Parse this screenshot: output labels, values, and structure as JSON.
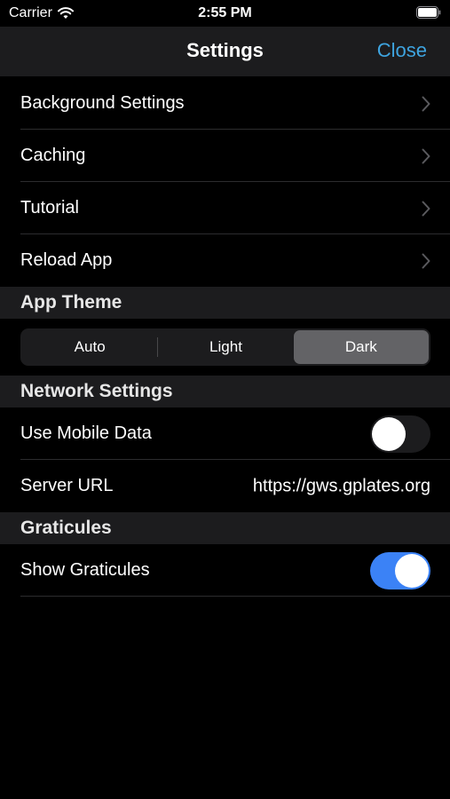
{
  "status": {
    "carrier": "Carrier",
    "time": "2:55 PM"
  },
  "nav": {
    "title": "Settings",
    "close": "Close"
  },
  "menu": [
    {
      "label": "Background Settings"
    },
    {
      "label": "Caching"
    },
    {
      "label": "Tutorial"
    },
    {
      "label": "Reload App"
    }
  ],
  "theme": {
    "header": "App Theme",
    "options": [
      "Auto",
      "Light",
      "Dark"
    ],
    "selected": "Dark"
  },
  "network": {
    "header": "Network Settings",
    "mobile_data_label": "Use Mobile Data",
    "mobile_data_on": false,
    "server_url_label": "Server URL",
    "server_url_value": "https://gws.gplates.org"
  },
  "graticules": {
    "header": "Graticules",
    "show_label": "Show Graticules",
    "show_on": true
  },
  "colors": {
    "accent": "#3ea4e0",
    "toggle_on": "#3b82f6",
    "background": "#000000",
    "header_bg": "#1c1c1e"
  }
}
